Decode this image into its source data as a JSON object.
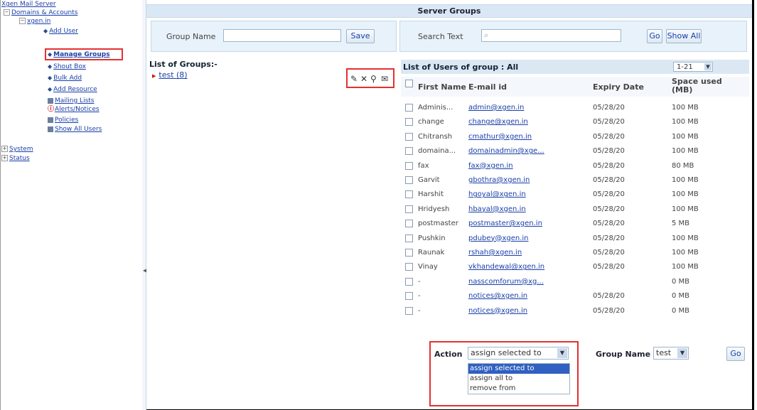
{
  "tree": {
    "root": "Xgen Mail Server",
    "domains": "Domains & Accounts",
    "domain": "xgen.in",
    "items": [
      {
        "label": "Add User"
      },
      {
        "label": "Manage Groups"
      },
      {
        "label": "Shout Box"
      },
      {
        "label": "Bulk Add"
      },
      {
        "label": "Add Resource"
      },
      {
        "label": "Mailing Lists"
      },
      {
        "label": "Alerts/Notices"
      },
      {
        "label": "Policies"
      },
      {
        "label": "Show All Users"
      }
    ],
    "system": "System",
    "status": "Status"
  },
  "page": {
    "title": "Server Groups"
  },
  "toolbar": {
    "group_name_label": "Group Name",
    "group_name_value": "",
    "save_label": "Save",
    "search_label": "Search Text",
    "search_value": "",
    "go_label": "Go",
    "show_all_label": "Show All"
  },
  "groups": {
    "header": "List of Groups:-",
    "items": [
      {
        "label": "test  (8)"
      }
    ]
  },
  "users": {
    "title": "List of Users of group : All",
    "pager": "1-21",
    "columns": [
      "First Name",
      "E-mail id",
      "Expiry Date",
      "Space used (MB)"
    ],
    "rows": [
      {
        "first": "Adminis...",
        "email": "admin@xgen.in",
        "expiry": "05/28/20",
        "space": "100 MB"
      },
      {
        "first": "change",
        "email": "change@xgen.in",
        "expiry": "05/28/20",
        "space": "100 MB"
      },
      {
        "first": "Chitransh",
        "email": "cmathur@xgen.in",
        "expiry": "05/28/20",
        "space": "100 MB"
      },
      {
        "first": "domaina...",
        "email": "domainadmin@xge...",
        "expiry": "05/28/20",
        "space": "100 MB"
      },
      {
        "first": "fax",
        "email": "fax@xgen.in",
        "expiry": "05/28/20",
        "space": "80 MB"
      },
      {
        "first": "Garvit",
        "email": "gbothra@xgen.in",
        "expiry": "05/28/20",
        "space": "100 MB"
      },
      {
        "first": "Harshit",
        "email": "hgoyal@xgen.in",
        "expiry": "05/28/20",
        "space": "100 MB"
      },
      {
        "first": "Hridyesh",
        "email": "hbayal@xgen.in",
        "expiry": "05/28/20",
        "space": "100 MB"
      },
      {
        "first": "postmaster",
        "email": "postmaster@xgen.in",
        "expiry": "05/28/20",
        "space": "5 MB"
      },
      {
        "first": "Pushkin",
        "email": "pdubey@xgen.in",
        "expiry": "05/28/20",
        "space": "100 MB"
      },
      {
        "first": "Raunak",
        "email": "rshah@xgen.in",
        "expiry": "05/28/20",
        "space": "100 MB"
      },
      {
        "first": "Vinay",
        "email": "vkhandewal@xgen.in",
        "expiry": "05/28/20",
        "space": "100 MB"
      },
      {
        "first": "-",
        "email": "nasscomforum@xg...",
        "expiry": "",
        "space": "0 MB"
      },
      {
        "first": "-",
        "email": "notices@xgen.in",
        "expiry": "05/28/20",
        "space": "0 MB"
      },
      {
        "first": "-",
        "email": "notices@xgen.in",
        "expiry": "05/28/20",
        "space": "0 MB"
      }
    ]
  },
  "action": {
    "label": "Action",
    "selected": "assign selected to",
    "options": [
      "assign selected to",
      "assign all to",
      "remove from"
    ],
    "group_name_label": "Group Name",
    "group_name_selected": "test",
    "go_label": "Go"
  },
  "colors": {
    "header_bg": "#d9e8f4",
    "link": "#1a3fa8",
    "highlight": "#e53030"
  }
}
